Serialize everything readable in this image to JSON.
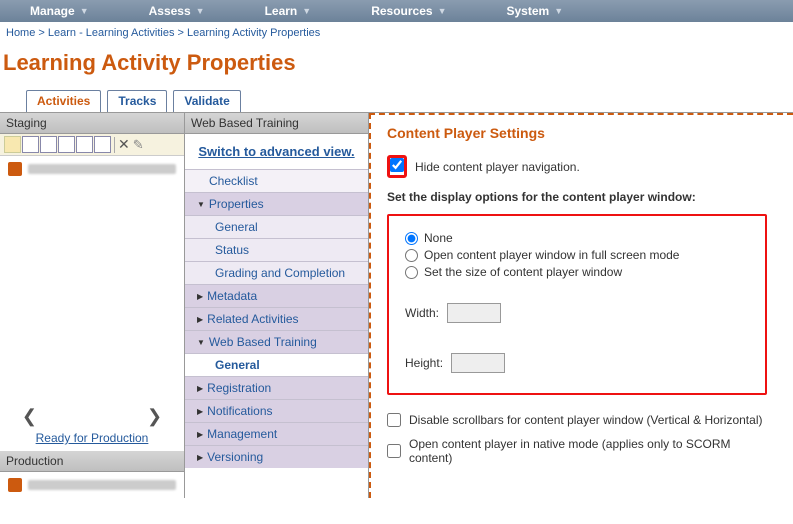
{
  "topnav": {
    "items": [
      "Manage",
      "Assess",
      "Learn",
      "Resources",
      "System"
    ]
  },
  "breadcrumbs": {
    "parts": [
      "Home",
      "Learn - Learning Activities",
      "Learning Activity Properties"
    ]
  },
  "page_title": "Learning Activity Properties",
  "tabs": {
    "activities": "Activities",
    "tracks": "Tracks",
    "validate": "Validate"
  },
  "left": {
    "staging_header": "Staging",
    "production_header": "Production",
    "ready_link": "Ready for Production"
  },
  "mid": {
    "header": "Web Based Training",
    "switch_link": "Switch to advanced view.",
    "items": {
      "checklist": "Checklist",
      "properties": "Properties",
      "general": "General",
      "status": "Status",
      "grading": "Grading and Completion",
      "metadata": "Metadata",
      "related": "Related Activities",
      "wbt": "Web Based Training",
      "wbt_general": "General",
      "registration": "Registration",
      "notifications": "Notifications",
      "management": "Management",
      "versioning": "Versioning"
    }
  },
  "right": {
    "title": "Content Player Settings",
    "hide_nav": "Hide content player navigation.",
    "display_label": "Set the display options for the content player window:",
    "radios": {
      "none": "None",
      "full": "Open content player window in full screen mode",
      "size": "Set the size of content player window"
    },
    "width_label": "Width:",
    "height_label": "Height:",
    "disable_scroll": "Disable scrollbars for content player window (Vertical & Horizontal)",
    "native_mode": "Open content player in native mode (applies only to SCORM content)"
  }
}
